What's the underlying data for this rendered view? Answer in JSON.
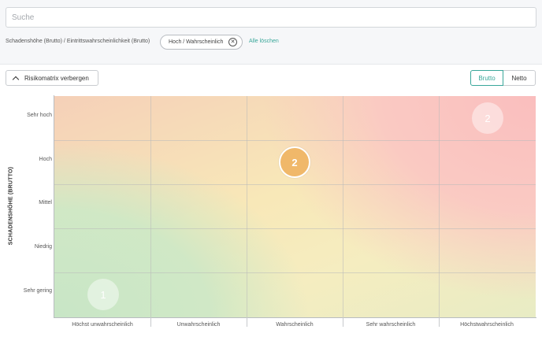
{
  "search": {
    "placeholder": "Suche"
  },
  "filters": {
    "label": "Schadenshöhe (Brutto) / Eintrittswahrscheinlichkeit (Brutto)",
    "chip_label": "Hoch / Wahrscheinlich",
    "clear_all": "Alle löschen"
  },
  "toolbar": {
    "toggle_label": "Risikomatrix verbergen",
    "segments": [
      "Brutto",
      "Netto"
    ],
    "selected_segment": "Brutto"
  },
  "matrix": {
    "y_axis_title": "SCHADENSHÖHE (BRUTTO)",
    "rows": [
      "Sehr hoch",
      "Hoch",
      "Mittel",
      "Niedrig",
      "Sehr gering"
    ],
    "columns": [
      "Höchst unwahrscheinlich",
      "Unwahrscheinlich",
      "Wahrscheinlich",
      "Sehr wahrscheinlich",
      "Höchstwahrscheinlich"
    ],
    "bubbles": [
      {
        "row": "Sehr hoch",
        "column": "Höchstwahrscheinlich",
        "count": "2",
        "active": false
      },
      {
        "row": "Hoch",
        "column": "Wahrscheinlich",
        "count": "2",
        "active": true
      },
      {
        "row": "Sehr gering",
        "column": "Höchst unwahrscheinlich",
        "count": "1",
        "active": false
      }
    ],
    "colors": {
      "accent": "#3aa79a",
      "active_bubble": "#f0b86a",
      "high_risk": "#f7c4c4",
      "low_risk": "#cde8c8"
    }
  }
}
